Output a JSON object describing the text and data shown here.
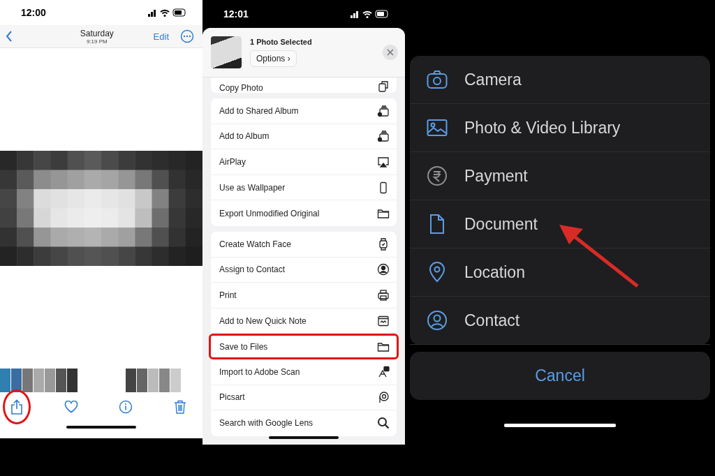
{
  "photos_screen": {
    "status_time": "12:00",
    "nav": {
      "title": "Saturday",
      "subtitle": "9:19 PM",
      "edit": "Edit"
    },
    "toolbar": [
      {
        "kind": "share",
        "highlighted": true
      },
      {
        "kind": "heart",
        "highlighted": false
      },
      {
        "kind": "info",
        "highlighted": false
      },
      {
        "kind": "trash",
        "highlighted": false
      }
    ]
  },
  "share_sheet": {
    "status_time": "12:01",
    "header": {
      "title": "1 Photo Selected",
      "options": "Options ›"
    },
    "groups": [
      [
        {
          "label": "Copy Photo",
          "kind": "copy",
          "highlighted": false
        }
      ],
      [
        {
          "label": "Add to Shared Album",
          "kind": "shared-album",
          "highlighted": false
        },
        {
          "label": "Add to Album",
          "kind": "album",
          "highlighted": false
        },
        {
          "label": "AirPlay",
          "kind": "airplay",
          "highlighted": false
        },
        {
          "label": "Use as Wallpaper",
          "kind": "phone",
          "highlighted": false
        },
        {
          "label": "Export Unmodified Original",
          "kind": "folder",
          "highlighted": false
        }
      ],
      [
        {
          "label": "Create Watch Face",
          "kind": "watch",
          "highlighted": false
        },
        {
          "label": "Assign to Contact",
          "kind": "contact",
          "highlighted": false
        },
        {
          "label": "Print",
          "kind": "printer",
          "highlighted": false
        },
        {
          "label": "Add to New Quick Note",
          "kind": "note",
          "highlighted": false
        },
        {
          "label": "Save to Files",
          "kind": "folder",
          "highlighted": true
        },
        {
          "label": "Import to Adobe Scan",
          "kind": "scan",
          "highlighted": false
        },
        {
          "label": "Picsart",
          "kind": "picsart",
          "highlighted": false
        },
        {
          "label": "Search with Google Lens",
          "kind": "search",
          "highlighted": false
        }
      ]
    ]
  },
  "attach_menu": {
    "items": [
      {
        "label": "Camera",
        "kind": "camera",
        "color": "#5b9de6",
        "pointed": false
      },
      {
        "label": "Photo & Video Library",
        "kind": "image",
        "color": "#5b9de6",
        "pointed": false
      },
      {
        "label": "Payment",
        "kind": "rupee",
        "color": "#8e8e93",
        "pointed": false
      },
      {
        "label": "Document",
        "kind": "document",
        "color": "#5b9de6",
        "pointed": true
      },
      {
        "label": "Location",
        "kind": "pin",
        "color": "#5b9de6",
        "pointed": false
      },
      {
        "label": "Contact",
        "kind": "person",
        "color": "#5b9de6",
        "pointed": false
      }
    ],
    "cancel": "Cancel"
  }
}
